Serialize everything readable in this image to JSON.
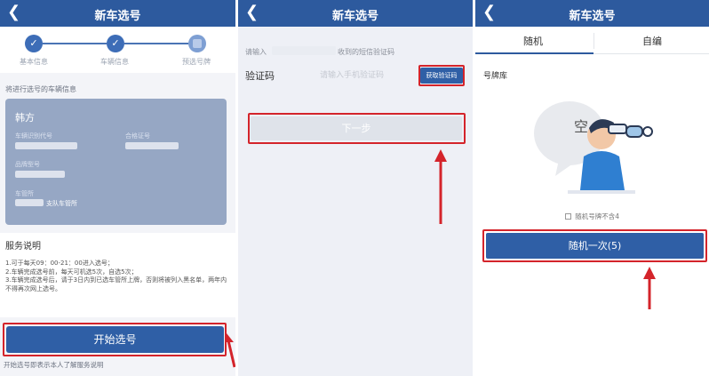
{
  "colors": {
    "primary": "#2d5a9e",
    "button": "#2f5fa6",
    "highlight": "#d4242b",
    "card": "#96a7c4"
  },
  "screen1": {
    "back_icon": "chevron-left-icon",
    "title": "新车选号",
    "steps": [
      {
        "label": "基本信息",
        "status": "done"
      },
      {
        "label": "车辆信息",
        "status": "done"
      },
      {
        "label": "预选号牌",
        "status": "pending"
      }
    ],
    "hint": "将进行选号的车辆信息",
    "card": {
      "owner": "韩方",
      "vin_label": "车辆识别代号",
      "cert_label": "合格证号",
      "model_label": "品牌型号",
      "dept_label": "车管所",
      "dept_value": "支队车管所"
    },
    "service": {
      "title": "服务说明",
      "lines": [
        "1.可于每天09：00-21：00进入选号；",
        "2.车辆完成选号前，每天可机选5次，自选5次；",
        "3.车辆完成选号后，请于3日内到已选车管所上牌，否则将被列入黑名单，两年内不得再次网上选号。"
      ]
    },
    "start_button": "开始选号",
    "note": "开始选号即表示本人了解服务说明"
  },
  "screen2": {
    "back_icon": "chevron-left-icon",
    "title": "新车选号",
    "sms_hint_prefix": "请输入",
    "sms_hint_suffix": "收到的短信验证码",
    "code_label": "验证码",
    "code_placeholder": "请输入手机验证码",
    "get_code_button": "获取验证码",
    "next_button": "下一步"
  },
  "screen3": {
    "back_icon": "chevron-left-icon",
    "title": "新车选号",
    "tabs": [
      "随机",
      "自编"
    ],
    "pool_label": "号牌库",
    "empty_bubble": "空",
    "empty_note": "随机号牌不含4",
    "random_button": "随机一次(5)"
  }
}
